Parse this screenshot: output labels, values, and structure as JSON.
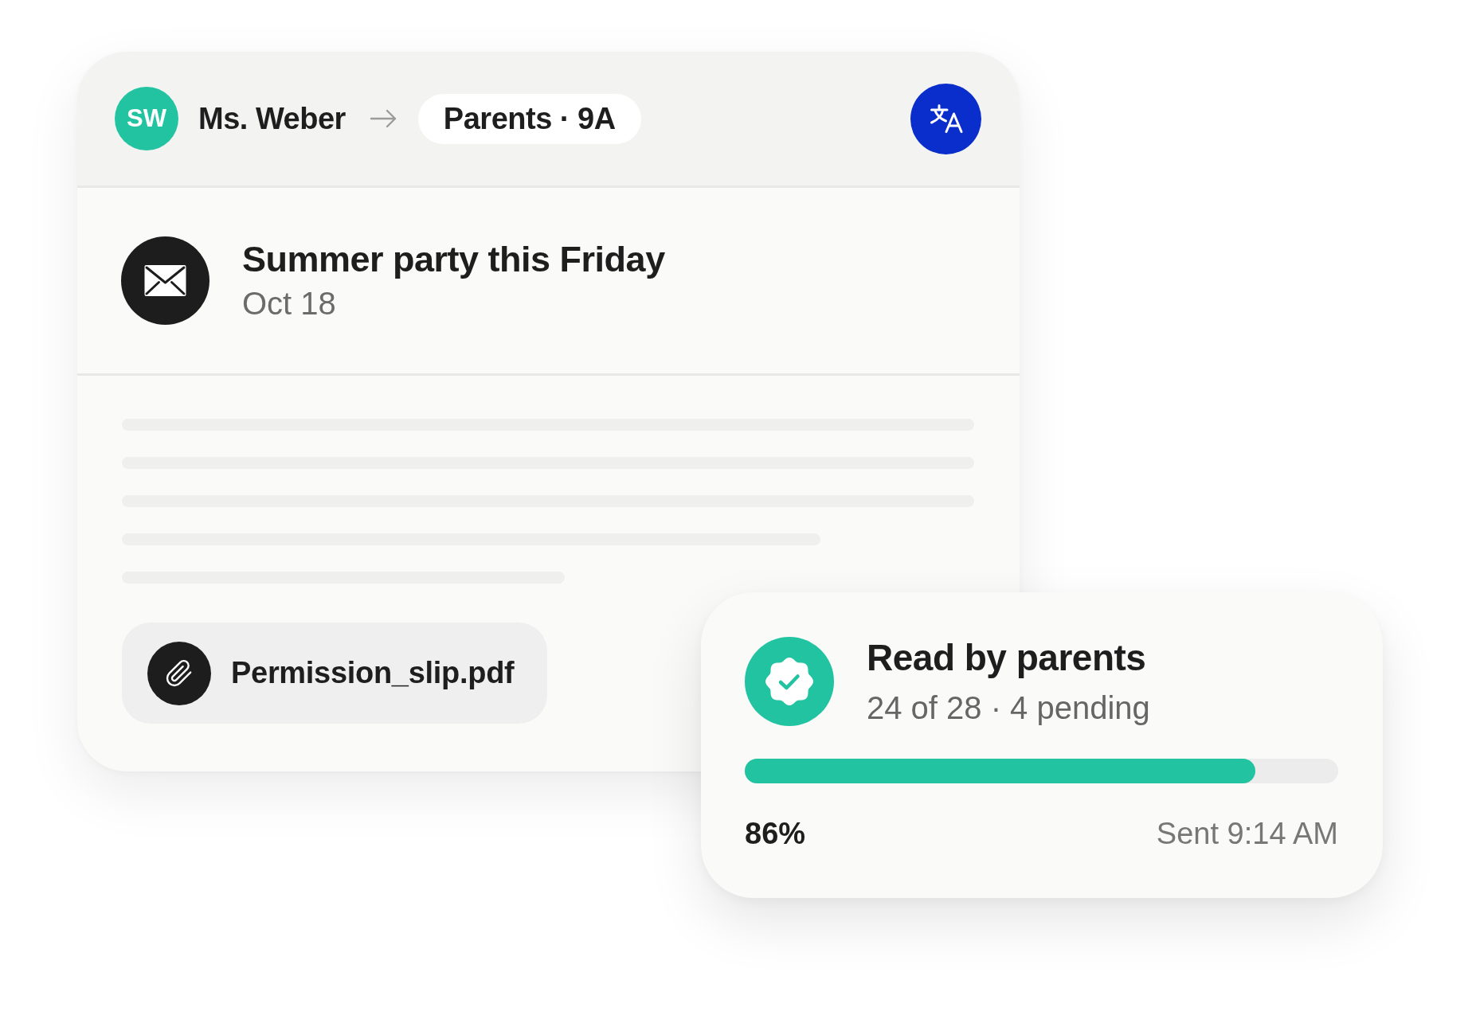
{
  "header": {
    "sender": {
      "initials": "SW",
      "name": "Ms. Weber"
    },
    "recipient": "Parents · 9A"
  },
  "message": {
    "title": "Summer party this Friday",
    "date": "Oct 18"
  },
  "attachment": {
    "file_name": "Permission_slip.pdf"
  },
  "read_status": {
    "title": "Read by parents",
    "summary": "24 of 28 · 4 pending",
    "level": 0.86,
    "percent": "86%",
    "sent": "Sent 9:14 AM"
  }
}
